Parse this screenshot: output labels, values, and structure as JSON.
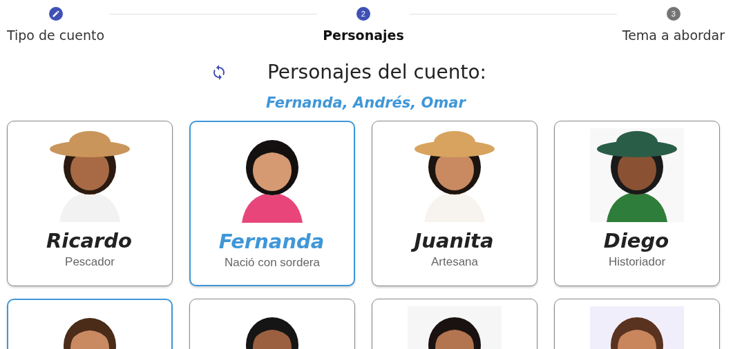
{
  "stepper": {
    "steps": [
      {
        "label": "Tipo de cuento",
        "completed": true,
        "selected": false
      },
      {
        "label": "Personajes",
        "number": "2",
        "completed": false,
        "selected": true
      },
      {
        "label": "Tema a abordar",
        "number": "3",
        "completed": false,
        "selected": false
      }
    ]
  },
  "heading": {
    "title": "Personajes del cuento:",
    "chosen": "Fernanda, Andrés, Omar"
  },
  "cards": [
    {
      "name": "Ricardo",
      "role": "Pescador",
      "selected": false
    },
    {
      "name": "Fernanda",
      "role": "Nació con sordera",
      "selected": true
    },
    {
      "name": "Juanita",
      "role": "Artesana",
      "selected": false
    },
    {
      "name": "Diego",
      "role": "Historiador",
      "selected": false
    },
    {
      "selected": true
    },
    {
      "selected": false
    },
    {
      "selected": false
    },
    {
      "selected": false
    }
  ]
}
